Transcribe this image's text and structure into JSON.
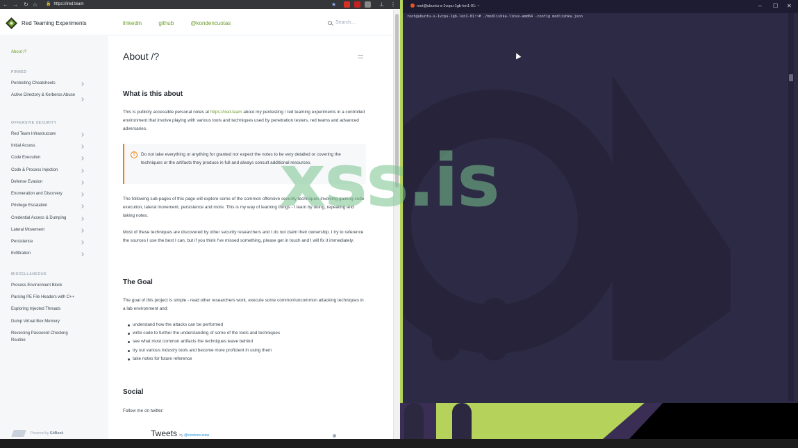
{
  "browser": {
    "url": "https://ired.team",
    "nav_icons": [
      "back-icon",
      "forward-icon",
      "reload-icon",
      "home-icon"
    ]
  },
  "header": {
    "site_title": "Red Teaming Experiments",
    "links": [
      "linkedin",
      "github",
      "@kondencuotas"
    ],
    "search_placeholder": "Search..."
  },
  "sidebar": {
    "current": "About /?",
    "sections": [
      {
        "title": "PINNED",
        "items": [
          "Pentesting Cheatsheets",
          "Active Directory & Kerberos Abuse"
        ]
      },
      {
        "title": "OFFENSIVE SECURITY",
        "items": [
          "Red Team Infrastructure",
          "Initial Access",
          "Code Execution",
          "Code & Process Injection",
          "Defense Evasion",
          "Enumeration and Discovery",
          "Privilege Escalation",
          "Credential Access & Dumping",
          "Lateral Movement",
          "Persistence",
          "Exfiltration"
        ]
      },
      {
        "title": "MISCELLANEOUS",
        "items": [
          "Process Environment Block",
          "Parsing PE File Headers with C++",
          "Exploring Injected Threads",
          "Dump Virtual Box Memory",
          "Reversing Password Checking Routine"
        ]
      }
    ],
    "powered_prefix": "Powered by",
    "powered_brand": "GitBook"
  },
  "page": {
    "title": "About /?",
    "h_what": "What is this about",
    "intro_1": "This is publicly accessible personal notes at",
    "intro_link": "https://ired.team",
    "intro_2": "about my pentesting / red teaming experiments in a controlled environment that involve playing with various tools and techniques used by penetration testers,  red teams and advanced adversaries.",
    "hint": "Do not take everything or anything for granted nor expect the notes to be very detailed or covering the techniques or the artifacts they produce in full and always consult additional resources.",
    "para_2": "The following sub-pages of this page will explore some of the common offensive security techniques involving gaining code execution, lateral movement, persistence and more. This is my way of learning things - I learn by doing, repeating and taking notes.",
    "para_3": "Most of these techniques are discovered by other security researchers and I do not claim their ownership. I try to reference the sources I use the best I can, but if you think I've missed something, please get in touch and I will fix it immediately.",
    "h_goal": "The Goal",
    "goal_text": "The goal of this project is simple - read other researchers work, execute some common/uncommon attacking techniques in a lab environment and:",
    "goal_list": [
      "understand how the attacks can be performed",
      "write code to further the understanding of some of the tools and techniques",
      "see what most common artifacts the techniques leave behind",
      "try out various industry tools and become more proficient in using them",
      "take notes for future reference"
    ],
    "h_social": "Social",
    "social_text": "Follow me on twitter:",
    "tweets_title": "Tweets",
    "tweets_by": "by",
    "tweets_handle": "@kondencuotas"
  },
  "terminal": {
    "title": "root@ubuntu-s-1vcpu-1gb-lon1-01: ~",
    "command_line": "root@ubuntu-s-1vcpu-1gb-lon1-01:~# ./modlishka-linux-amd64 -config modlishka.json"
  },
  "watermark": "xss.is",
  "colors": {
    "accent_green": "#6b9c28",
    "hint_orange": "#f77d05",
    "terminal_bg": "#2d2a45",
    "wallpaper_green": "#b5d35a"
  }
}
